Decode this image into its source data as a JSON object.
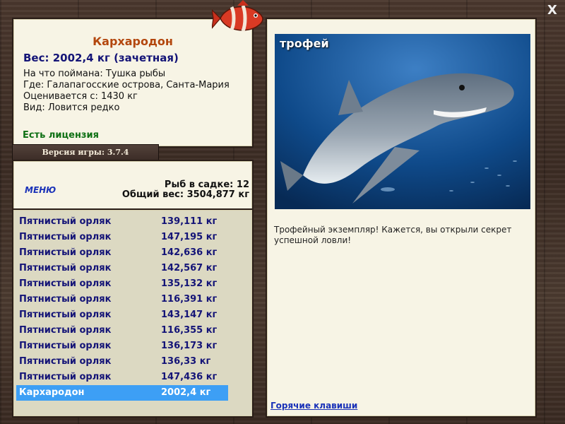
{
  "info": {
    "fish_name": "Кархародон",
    "weight": "Вес: 2002,4 кг (зачетная)",
    "caught_on": "На что поймана: Тушка рыбы",
    "location": "Где: Галапагосские острова, Санта-Мария",
    "valued_from": "Оценивается с: 1430 кг",
    "rarity": "Вид: Ловится редко",
    "license": "Есть лицензия"
  },
  "version": "Версия игры: 3.7.4",
  "keepnet": {
    "menu_label": "МЕНЮ",
    "fish_count": "Рыб в садке: 12",
    "total_weight": "Общий вес: 3504,877 кг"
  },
  "fish_list": [
    {
      "name": "Пятнистый орляк",
      "weight": "139,111 кг"
    },
    {
      "name": "Пятнистый орляк",
      "weight": "147,195 кг"
    },
    {
      "name": "Пятнистый орляк",
      "weight": "142,636 кг"
    },
    {
      "name": "Пятнистый орляк",
      "weight": "142,567 кг"
    },
    {
      "name": "Пятнистый орляк",
      "weight": "135,132 кг"
    },
    {
      "name": "Пятнистый орляк",
      "weight": "116,391 кг"
    },
    {
      "name": "Пятнистый орляк",
      "weight": "143,147 кг"
    },
    {
      "name": "Пятнистый орляк",
      "weight": "116,355 кг"
    },
    {
      "name": "Пятнистый орляк",
      "weight": "136,173 кг"
    },
    {
      "name": "Пятнистый орляк",
      "weight": "136,33 кг"
    },
    {
      "name": "Пятнистый орляк",
      "weight": "147,436 кг"
    },
    {
      "name": "Кархародон",
      "weight": "2002,4 кг"
    }
  ],
  "photo": {
    "trophy_label": "трофей",
    "description": "Трофейный экземпляр! Кажется, вы открыли секрет успешной ловли!"
  },
  "hotkeys_label": "Горячие клавиши",
  "close_label": "X",
  "icons": {
    "logo": "red-fish-logo-icon",
    "close": "close-icon"
  },
  "colors": {
    "selected_row": "#3d9ff5",
    "fish_name": "#b3470e",
    "license": "#0e7014",
    "list_text": "#141477"
  }
}
